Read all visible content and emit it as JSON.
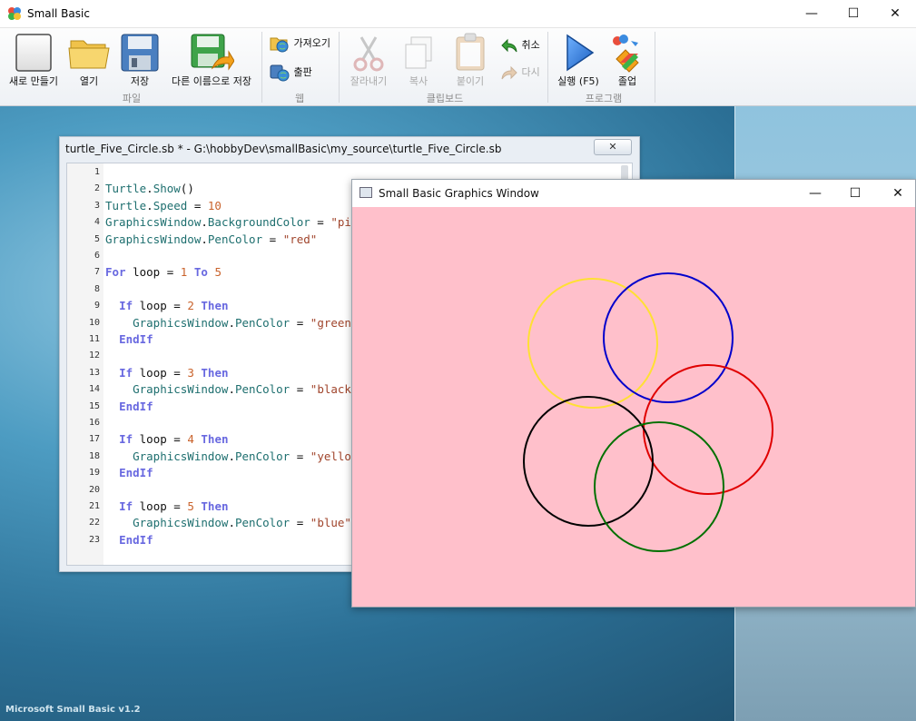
{
  "app": {
    "title": "Small Basic",
    "controls": {
      "minimize": "—",
      "maximize": "☐",
      "close": "✕"
    }
  },
  "ribbon": {
    "file_group": {
      "label": "파일",
      "new_label": "새로 만들기",
      "open_label": "열기",
      "save_label": "저장",
      "save_as_label": "다른 이름으로 저장"
    },
    "web_group": {
      "label": "웹",
      "import_label": "가져오기",
      "publish_label": "출판"
    },
    "clipboard_group": {
      "label": "클립보드",
      "cut_label": "잘라내기",
      "copy_label": "복사",
      "paste_label": "붙이기",
      "undo_label": "취소",
      "redo_label": "다시"
    },
    "program_group": {
      "label": "프로그램",
      "run_label": "실행 (F5)",
      "graduate_label": "졸업"
    }
  },
  "editor": {
    "title": "turtle_Five_Circle.sb * - G:\\hobbyDev\\smallBasic\\my_source\\turtle_Five_Circle.sb",
    "close_label": "✕",
    "lines": [
      {
        "n": "1",
        "tokens": []
      },
      {
        "n": "2",
        "tokens": [
          {
            "t": "Turtle",
            "c": "obj"
          },
          {
            "t": ".",
            "c": "op"
          },
          {
            "t": "Show",
            "c": "obj"
          },
          {
            "t": "()",
            "c": "op"
          }
        ]
      },
      {
        "n": "3",
        "tokens": [
          {
            "t": "Turtle",
            "c": "obj"
          },
          {
            "t": ".",
            "c": "op"
          },
          {
            "t": "Speed",
            "c": "obj"
          },
          {
            "t": " = ",
            "c": "op"
          },
          {
            "t": "10",
            "c": "num"
          }
        ]
      },
      {
        "n": "4",
        "tokens": [
          {
            "t": "GraphicsWindow",
            "c": "obj"
          },
          {
            "t": ".",
            "c": "op"
          },
          {
            "t": "BackgroundColor",
            "c": "obj"
          },
          {
            "t": " = ",
            "c": "op"
          },
          {
            "t": "\"pink\"",
            "c": "str"
          }
        ]
      },
      {
        "n": "5",
        "tokens": [
          {
            "t": "GraphicsWindow",
            "c": "obj"
          },
          {
            "t": ".",
            "c": "op"
          },
          {
            "t": "PenColor",
            "c": "obj"
          },
          {
            "t": " = ",
            "c": "op"
          },
          {
            "t": "\"red\"",
            "c": "str"
          }
        ]
      },
      {
        "n": "6",
        "tokens": []
      },
      {
        "n": "7",
        "tokens": [
          {
            "t": "For",
            "c": "kw"
          },
          {
            "t": " loop = ",
            "c": "id"
          },
          {
            "t": "1",
            "c": "num"
          },
          {
            "t": " ",
            "c": "op"
          },
          {
            "t": "To",
            "c": "kw"
          },
          {
            "t": " ",
            "c": "op"
          },
          {
            "t": "5",
            "c": "num"
          }
        ]
      },
      {
        "n": "8",
        "tokens": []
      },
      {
        "n": "9",
        "tokens": [
          {
            "t": "  ",
            "c": "op"
          },
          {
            "t": "If",
            "c": "kw"
          },
          {
            "t": " loop = ",
            "c": "id"
          },
          {
            "t": "2",
            "c": "num"
          },
          {
            "t": " ",
            "c": "op"
          },
          {
            "t": "Then",
            "c": "kw"
          }
        ]
      },
      {
        "n": "10",
        "tokens": [
          {
            "t": "    GraphicsWindow",
            "c": "obj"
          },
          {
            "t": ".",
            "c": "op"
          },
          {
            "t": "PenColor",
            "c": "obj"
          },
          {
            "t": " = ",
            "c": "op"
          },
          {
            "t": "\"green\"",
            "c": "str"
          }
        ]
      },
      {
        "n": "11",
        "tokens": [
          {
            "t": "  ",
            "c": "op"
          },
          {
            "t": "EndIf",
            "c": "kw"
          }
        ]
      },
      {
        "n": "12",
        "tokens": []
      },
      {
        "n": "13",
        "tokens": [
          {
            "t": "  ",
            "c": "op"
          },
          {
            "t": "If",
            "c": "kw"
          },
          {
            "t": " loop = ",
            "c": "id"
          },
          {
            "t": "3",
            "c": "num"
          },
          {
            "t": " ",
            "c": "op"
          },
          {
            "t": "Then",
            "c": "kw"
          }
        ]
      },
      {
        "n": "14",
        "tokens": [
          {
            "t": "    GraphicsWindow",
            "c": "obj"
          },
          {
            "t": ".",
            "c": "op"
          },
          {
            "t": "PenColor",
            "c": "obj"
          },
          {
            "t": " = ",
            "c": "op"
          },
          {
            "t": "\"black\"",
            "c": "str"
          }
        ]
      },
      {
        "n": "15",
        "tokens": [
          {
            "t": "  ",
            "c": "op"
          },
          {
            "t": "EndIf",
            "c": "kw"
          }
        ]
      },
      {
        "n": "16",
        "tokens": []
      },
      {
        "n": "17",
        "tokens": [
          {
            "t": "  ",
            "c": "op"
          },
          {
            "t": "If",
            "c": "kw"
          },
          {
            "t": " loop = ",
            "c": "id"
          },
          {
            "t": "4",
            "c": "num"
          },
          {
            "t": " ",
            "c": "op"
          },
          {
            "t": "Then",
            "c": "kw"
          }
        ]
      },
      {
        "n": "18",
        "tokens": [
          {
            "t": "    GraphicsWindow",
            "c": "obj"
          },
          {
            "t": ".",
            "c": "op"
          },
          {
            "t": "PenColor",
            "c": "obj"
          },
          {
            "t": " = ",
            "c": "op"
          },
          {
            "t": "\"yellow\"",
            "c": "str"
          }
        ]
      },
      {
        "n": "19",
        "tokens": [
          {
            "t": "  ",
            "c": "op"
          },
          {
            "t": "EndIf",
            "c": "kw"
          }
        ]
      },
      {
        "n": "20",
        "tokens": []
      },
      {
        "n": "21",
        "tokens": [
          {
            "t": "  ",
            "c": "op"
          },
          {
            "t": "If",
            "c": "kw"
          },
          {
            "t": " loop = ",
            "c": "id"
          },
          {
            "t": "5",
            "c": "num"
          },
          {
            "t": " ",
            "c": "op"
          },
          {
            "t": "Then",
            "c": "kw"
          }
        ]
      },
      {
        "n": "22",
        "tokens": [
          {
            "t": "    GraphicsWindow",
            "c": "obj"
          },
          {
            "t": ".",
            "c": "op"
          },
          {
            "t": "PenColor",
            "c": "obj"
          },
          {
            "t": " = ",
            "c": "op"
          },
          {
            "t": "\"blue\"",
            "c": "str"
          }
        ]
      },
      {
        "n": "23",
        "tokens": [
          {
            "t": "  ",
            "c": "op"
          },
          {
            "t": "EndIf",
            "c": "kw"
          }
        ]
      }
    ]
  },
  "graphics_window": {
    "title": "Small Basic Graphics Window",
    "background_color": "#ffc0cb",
    "controls": {
      "minimize": "—",
      "maximize": "☐",
      "close": "✕"
    },
    "circles": [
      {
        "color": "#ffe033",
        "label": "yellow"
      },
      {
        "color": "#0000cc",
        "label": "blue"
      },
      {
        "color": "#e00000",
        "label": "red"
      },
      {
        "color": "#000000",
        "label": "black"
      },
      {
        "color": "#007000",
        "label": "green"
      }
    ]
  },
  "status": {
    "version": "Microsoft Small Basic v1.2"
  }
}
